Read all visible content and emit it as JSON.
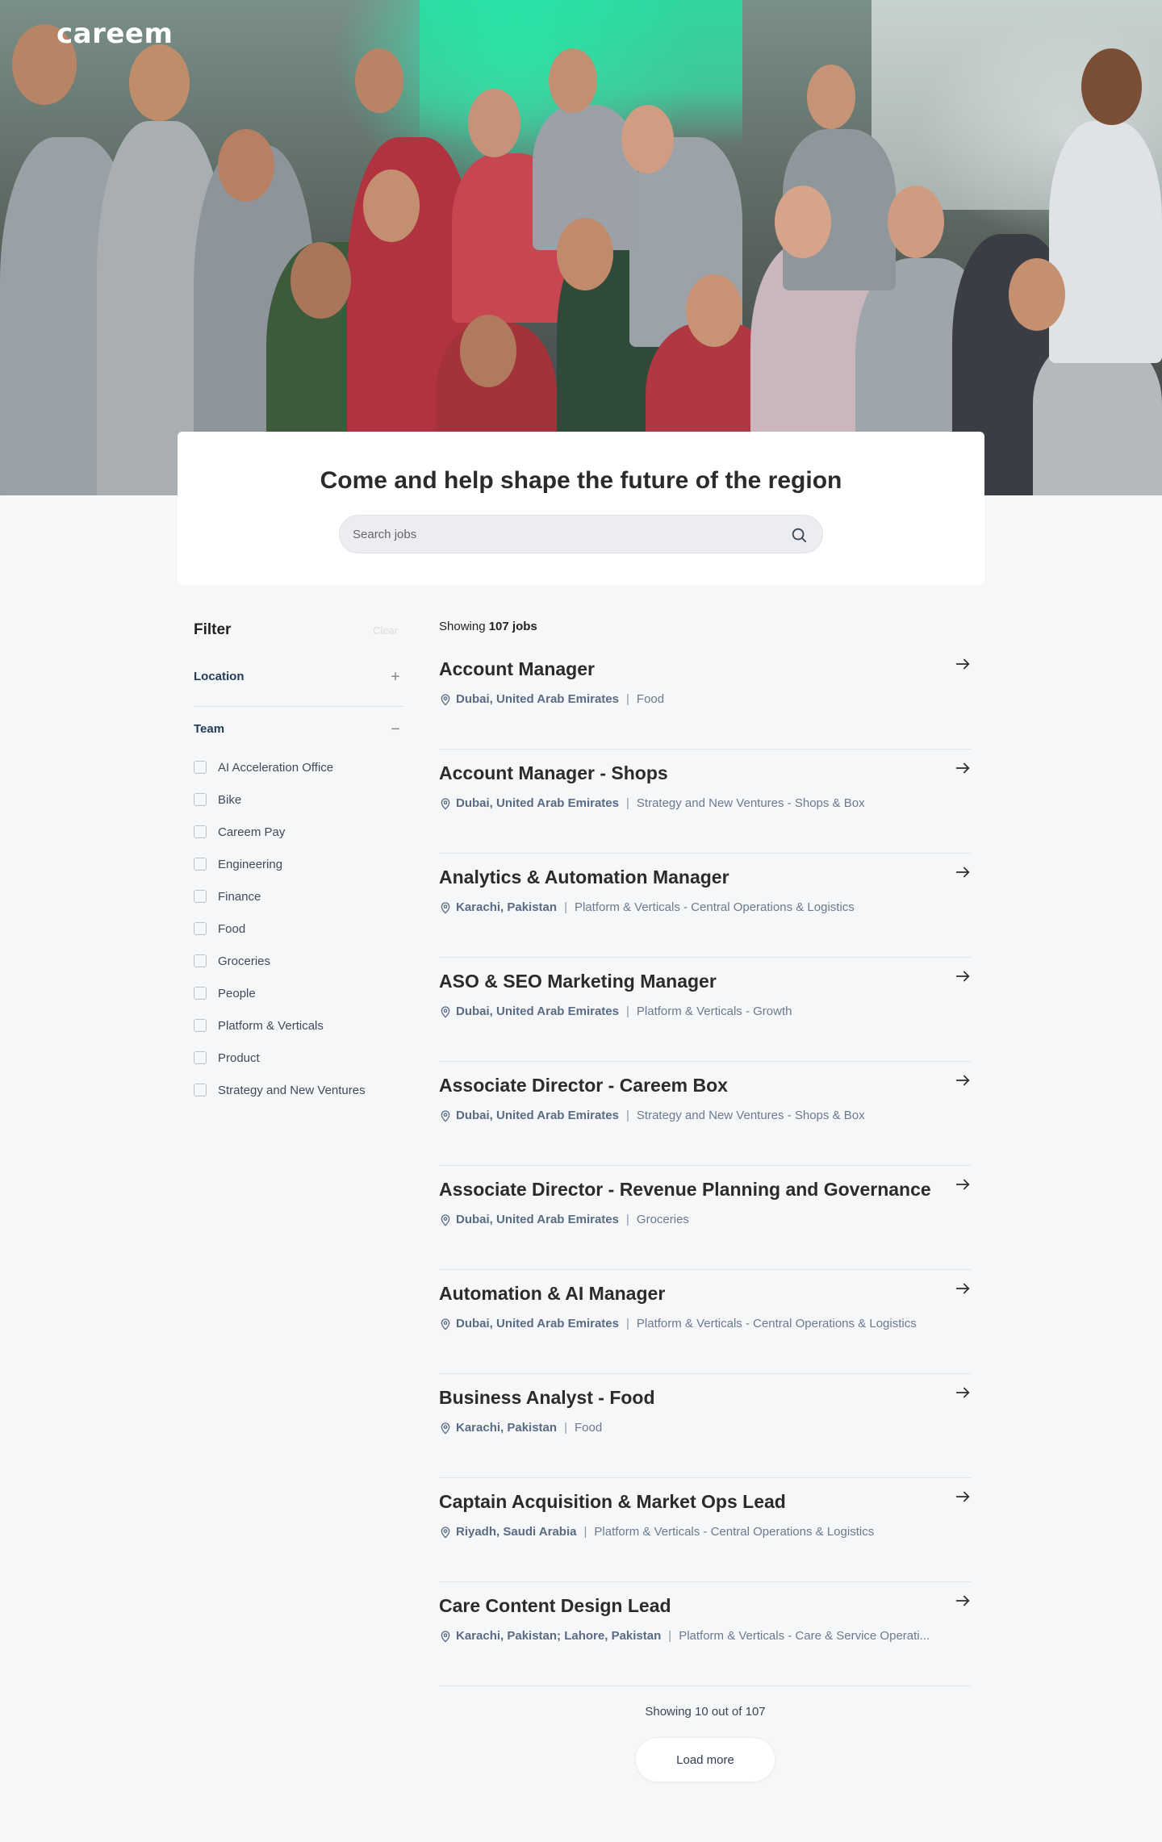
{
  "brand": {
    "logo_text": "careem"
  },
  "hero": {
    "heading": "Come and help shape the future of the region"
  },
  "search": {
    "placeholder": "Search jobs"
  },
  "filter": {
    "title": "Filter",
    "clear_label": "Clear",
    "location": {
      "label": "Location",
      "toggle": "+"
    },
    "team": {
      "label": "Team",
      "toggle": "−",
      "options": [
        "AI Acceleration Office",
        "Bike",
        "Careem Pay",
        "Engineering",
        "Finance",
        "Food",
        "Groceries",
        "People",
        "Platform & Verticals",
        "Product",
        "Strategy and New Ventures"
      ]
    }
  },
  "results": {
    "showing_prefix": "Showing",
    "total_label": "107 jobs",
    "jobs": [
      {
        "title": "Account Manager",
        "location": "Dubai, United Arab Emirates",
        "team": "Food"
      },
      {
        "title": "Account Manager - Shops",
        "location": "Dubai, United Arab Emirates",
        "team": "Strategy and New Ventures - Shops & Box"
      },
      {
        "title": "Analytics & Automation Manager",
        "location": "Karachi, Pakistan",
        "team": "Platform & Verticals - Central Operations & Logistics"
      },
      {
        "title": "ASO & SEO Marketing Manager",
        "location": "Dubai, United Arab Emirates",
        "team": "Platform & Verticals - Growth"
      },
      {
        "title": "Associate Director - Careem Box",
        "location": "Dubai, United Arab Emirates",
        "team": "Strategy and New Ventures - Shops & Box"
      },
      {
        "title": "Associate Director - Revenue Planning and Governance",
        "location": "Dubai, United Arab Emirates",
        "team": "Groceries"
      },
      {
        "title": "Automation & AI Manager",
        "location": "Dubai, United Arab Emirates",
        "team": "Platform & Verticals - Central Operations & Logistics"
      },
      {
        "title": "Business Analyst - Food",
        "location": "Karachi, Pakistan",
        "team": "Food"
      },
      {
        "title": "Captain Acquisition & Market Ops Lead",
        "location": "Riyadh, Saudi Arabia",
        "team": "Platform & Verticals - Central Operations & Logistics"
      },
      {
        "title": "Care Content Design Lead",
        "location": "Karachi, Pakistan; Lahore, Pakistan",
        "team": "Platform & Verticals - Care & Service Operati..."
      }
    ],
    "separator": "|",
    "pagination_text": "Showing 10 out of 107",
    "load_more_label": "Load more"
  },
  "colors": {
    "accent_green": "#1fe7a6",
    "location_text": "#5a6b84",
    "team_text": "#6b7a90"
  },
  "icons": [
    "search-icon",
    "location-pin-icon",
    "arrow-right-icon",
    "plus-icon",
    "minus-icon"
  ]
}
